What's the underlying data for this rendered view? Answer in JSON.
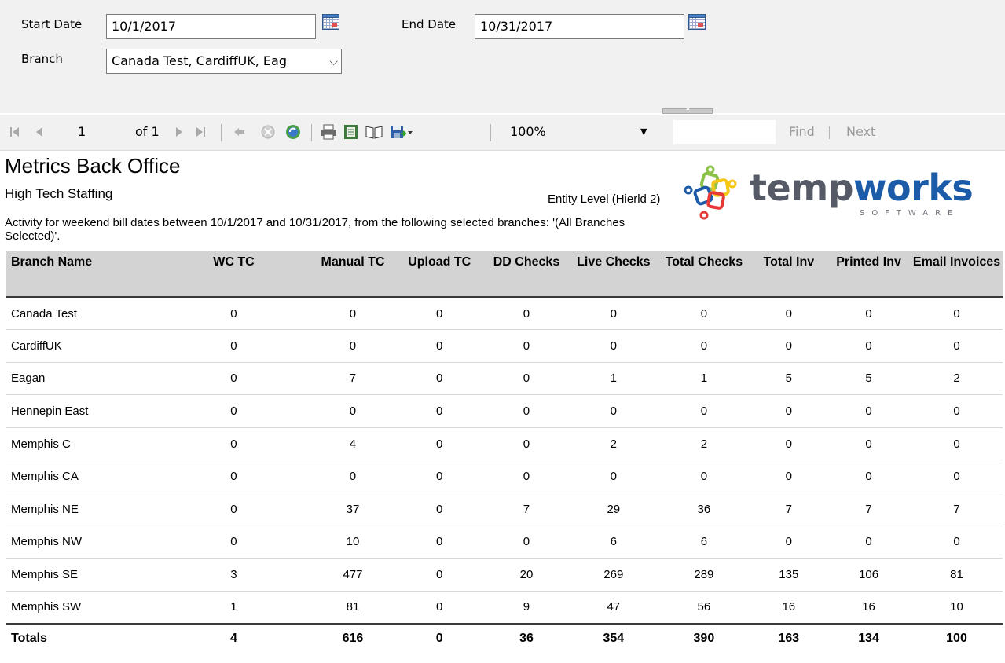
{
  "params": {
    "start_date_label": "Start Date",
    "start_date_value": "10/1/2017",
    "end_date_label": "End Date",
    "end_date_value": "10/31/2017",
    "branch_label": "Branch",
    "branch_value": "Canada Test, CardiffUK, Eag"
  },
  "toolbar": {
    "page_current": "1",
    "page_of": "of 1",
    "zoom": "100%",
    "find_label": "Find",
    "next_label": "Next",
    "icons": [
      "first-page-icon",
      "previous-page-icon",
      "next-page-icon",
      "last-page-icon",
      "back-icon",
      "stop-icon",
      "refresh-icon",
      "print-icon",
      "page-setup-icon",
      "print-layout-icon",
      "export-icon"
    ]
  },
  "report": {
    "title": "Metrics Back Office",
    "company": "High Tech Staffing",
    "entity": "Entity Level (Hierld 2)",
    "description": "Activity for weekend bill dates between 10/1/2017 and 10/31/2017, from the following selected branches: '(All Branches Selected)'.",
    "logo": {
      "text_a": "temp",
      "text_b": "works",
      "tagline": "SOFTWARE",
      "colors": {
        "temp": "#555a66",
        "works": "#1c5ba8"
      }
    }
  },
  "table": {
    "headers": [
      "Branch Name",
      "WC TC",
      "Manual TC",
      "Upload TC",
      "DD Checks",
      "Live Checks",
      "Total Checks",
      "Total Inv",
      "Printed Inv",
      "Email Invoices"
    ],
    "rows": [
      [
        "Canada Test",
        "0",
        "0",
        "0",
        "0",
        "0",
        "0",
        "0",
        "0",
        "0"
      ],
      [
        "CardiffUK",
        "0",
        "0",
        "0",
        "0",
        "0",
        "0",
        "0",
        "0",
        "0"
      ],
      [
        "Eagan",
        "0",
        "7",
        "0",
        "0",
        "1",
        "1",
        "5",
        "5",
        "2"
      ],
      [
        "Hennepin East",
        "0",
        "0",
        "0",
        "0",
        "0",
        "0",
        "0",
        "0",
        "0"
      ],
      [
        "Memphis C",
        "0",
        "4",
        "0",
        "0",
        "2",
        "2",
        "0",
        "0",
        "0"
      ],
      [
        "Memphis CA",
        "0",
        "0",
        "0",
        "0",
        "0",
        "0",
        "0",
        "0",
        "0"
      ],
      [
        "Memphis NE",
        "0",
        "37",
        "0",
        "7",
        "29",
        "36",
        "7",
        "7",
        "7"
      ],
      [
        "Memphis NW",
        "0",
        "10",
        "0",
        "0",
        "6",
        "6",
        "0",
        "0",
        "0"
      ],
      [
        "Memphis SE",
        "3",
        "477",
        "0",
        "20",
        "269",
        "289",
        "135",
        "106",
        "81"
      ],
      [
        "Memphis SW",
        "1",
        "81",
        "0",
        "9",
        "47",
        "56",
        "16",
        "16",
        "10"
      ]
    ],
    "totals": [
      "Totals",
      "4",
      "616",
      "0",
      "36",
      "354",
      "390",
      "163",
      "134",
      "100"
    ]
  }
}
